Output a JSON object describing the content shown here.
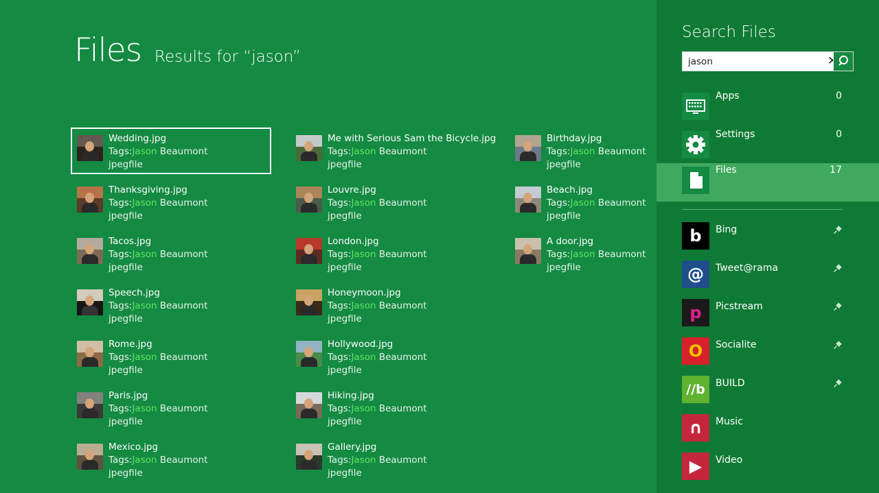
{
  "page": {
    "title": "Files",
    "subtitle": "Results for “jason”"
  },
  "results": [
    [
      {
        "name": "Wedding.jpg",
        "tags_label": "Tags:",
        "tag": "Jason",
        "tag_rest": " Beaumont",
        "type": "jpegfile",
        "colors": [
          "#6a5f55",
          "#2b2320"
        ],
        "selected": true
      },
      {
        "name": "Thanksgiving.jpg",
        "tags_label": "Tags:",
        "tag": "Jason",
        "tag_rest": " Beaumont",
        "type": "jpegfile",
        "colors": [
          "#c07a4a",
          "#5a3a28"
        ]
      },
      {
        "name": "Tacos.jpg",
        "tags_label": "Tags:",
        "tag": "Jason",
        "tag_rest": " Beaumont",
        "type": "jpegfile",
        "colors": [
          "#b9b3a6",
          "#7c6a55"
        ]
      },
      {
        "name": "Speech.jpg",
        "tags_label": "Tags:",
        "tag": "Jason",
        "tag_rest": " Beaumont",
        "type": "jpegfile",
        "colors": [
          "#e8e0cf",
          "#151515"
        ]
      },
      {
        "name": "Rome.jpg",
        "tags_label": "Tags:",
        "tag": "Jason",
        "tag_rest": " Beaumont",
        "type": "jpegfile",
        "colors": [
          "#d9c8b0",
          "#8c6a48"
        ]
      },
      {
        "name": "Paris.jpg",
        "tags_label": "Tags:",
        "tag": "Jason",
        "tag_rest": " Beaumont",
        "type": "jpegfile",
        "colors": [
          "#8b8a86",
          "#3b3a38"
        ]
      },
      {
        "name": "Mexico.jpg",
        "tags_label": "Tags:",
        "tag": "Jason",
        "tag_rest": " Beaumont",
        "type": "jpegfile",
        "colors": [
          "#c4b79a",
          "#5e5240"
        ]
      }
    ],
    [
      {
        "name": "Me with Serious Sam the Bicycle.jpg",
        "tags_label": "Tags:",
        "tag": "Jason",
        "tag_rest": " Beaumont",
        "type": "jpegfile",
        "colors": [
          "#cfd6d8",
          "#4a6a3a"
        ]
      },
      {
        "name": "Louvre.jpg",
        "tags_label": "Tags:",
        "tag": "Jason",
        "tag_rest": " Beaumont",
        "type": "jpegfile",
        "colors": [
          "#b48a5a",
          "#4c5a4a"
        ]
      },
      {
        "name": "London.jpg",
        "tags_label": "Tags:",
        "tag": "Jason",
        "tag_rest": " Beaumont",
        "type": "jpegfile",
        "colors": [
          "#c23a2e",
          "#5c2a24"
        ]
      },
      {
        "name": "Honeymoon.jpg",
        "tags_label": "Tags:",
        "tag": "Jason",
        "tag_rest": " Beaumont",
        "type": "jpegfile",
        "colors": [
          "#d8b06a",
          "#3a2a18"
        ]
      },
      {
        "name": "Hollywood.jpg",
        "tags_label": "Tags:",
        "tag": "Jason",
        "tag_rest": " Beaumont",
        "type": "jpegfile",
        "colors": [
          "#9ab8d0",
          "#4a8a4a"
        ]
      },
      {
        "name": "Hiking.jpg",
        "tags_label": "Tags:",
        "tag": "Jason",
        "tag_rest": " Beaumont",
        "type": "jpegfile",
        "colors": [
          "#dfe6ea",
          "#7a6a5a"
        ]
      },
      {
        "name": "Gallery.jpg",
        "tags_label": "Tags:",
        "tag": "Jason",
        "tag_rest": " Beaumont",
        "type": "jpegfile",
        "colors": [
          "#d8d2c4",
          "#2a3a2a"
        ]
      }
    ],
    [
      {
        "name": "Birthday.jpg",
        "tags_label": "Tags:",
        "tag": "Jason",
        "tag_rest": " Beaumont",
        "type": "jpegfile",
        "colors": [
          "#b8a890",
          "#6a7a8a"
        ]
      },
      {
        "name": "Beach.jpg",
        "tags_label": "Tags:",
        "tag": "Jason",
        "tag_rest": " Beaumont",
        "type": "jpegfile",
        "colors": [
          "#c6d2da",
          "#8a8a7a"
        ]
      },
      {
        "name": "A door.jpg",
        "tags_label": "Tags:",
        "tag": "Jason",
        "tag_rest": " Beaumont",
        "type": "jpegfile",
        "colors": [
          "#cfc6b2",
          "#8a7a62"
        ]
      }
    ]
  ],
  "search_pane": {
    "title": "Search Files",
    "query": "jason",
    "scopes": [
      {
        "name": "Apps",
        "count": "0",
        "icon": "apps-keyboard-icon"
      },
      {
        "name": "Settings",
        "count": "0",
        "icon": "gear-icon"
      },
      {
        "name": "Files",
        "count": "17",
        "icon": "file-icon",
        "active": true
      }
    ],
    "apps": [
      {
        "name": "Bing",
        "icon": "bing-icon",
        "tile_color": "#000000",
        "glyph": "b",
        "glyph_color": "#ffffff"
      },
      {
        "name": "Tweet@rama",
        "icon": "tweetarama-icon",
        "tile_color": "#1f4e8c",
        "glyph": "@",
        "glyph_color": "#ffffff"
      },
      {
        "name": "Picstream",
        "icon": "picstream-icon",
        "tile_color": "#1a1a1a",
        "glyph": "p",
        "glyph_color": "#e0208c"
      },
      {
        "name": "Socialite",
        "icon": "socialite-icon",
        "tile_color": "#d6202a",
        "glyph": "O",
        "glyph_color": "#f5c400"
      },
      {
        "name": "BUILD",
        "icon": "build-icon",
        "tile_color": "#5fb32f",
        "glyph": "//b",
        "glyph_color": "#ffffff"
      },
      {
        "name": "Music",
        "icon": "headphones-icon",
        "tile_color": "#c4263b",
        "glyph": "∩",
        "glyph_color": "#ffffff"
      },
      {
        "name": "Video",
        "icon": "video-icon",
        "tile_color": "#c4263b",
        "glyph": "▶",
        "glyph_color": "#ffffff"
      }
    ]
  }
}
